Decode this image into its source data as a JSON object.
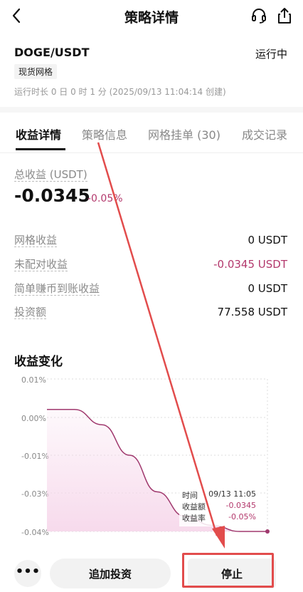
{
  "header": {
    "title": "策略详情"
  },
  "strategy": {
    "pair": "DOGE/USDT",
    "status": "运行中",
    "tag": "现货网格",
    "runtime": "运行时长 0 日 0 时 1 分 (2025/09/13 11:04:14 创建)"
  },
  "tabs": [
    {
      "label": "收益详情"
    },
    {
      "label": "策略信息"
    },
    {
      "label": "网格挂单 (30)"
    },
    {
      "label": "成交记录"
    }
  ],
  "total": {
    "label": "总收益 (USDT)",
    "value": "-0.0345",
    "pct": "-0.05%"
  },
  "rows": [
    {
      "label": "网格收益",
      "value": "0 USDT"
    },
    {
      "label": "未配对收益",
      "value": "-0.0345 USDT"
    },
    {
      "label": "简单赚币到账收益",
      "value": "0 USDT"
    },
    {
      "label": "投资额",
      "value": "77.558 USDT"
    }
  ],
  "chart_section": {
    "title": "收益变化"
  },
  "chart_data": {
    "type": "area",
    "title": "收益变化",
    "y_tick_labels": [
      "0.01%",
      "0.00%",
      "-0.01%",
      "-0.03%",
      "-0.04%"
    ],
    "ylim": [
      -0.04,
      0.01
    ],
    "series": [
      {
        "values": [
          0.0,
          0.0,
          -0.005,
          -0.015,
          -0.027,
          -0.035,
          -0.038,
          -0.04,
          -0.04
        ]
      }
    ],
    "grid": true,
    "tooltip": {
      "time_label": "时间",
      "time_value": "09/13 11:05",
      "amount_label": "收益额",
      "amount_value": "-0.0345",
      "rate_label": "收益率",
      "rate_value": "-0.05%"
    },
    "colors": {
      "line": "#a0396e",
      "fill": "#f6d6ea"
    }
  },
  "bottom": {
    "more": "•••",
    "invest": "追加投资",
    "stop": "停止"
  },
  "colors": {
    "negative": "#b3386c",
    "annotation": "#e24c4c"
  }
}
